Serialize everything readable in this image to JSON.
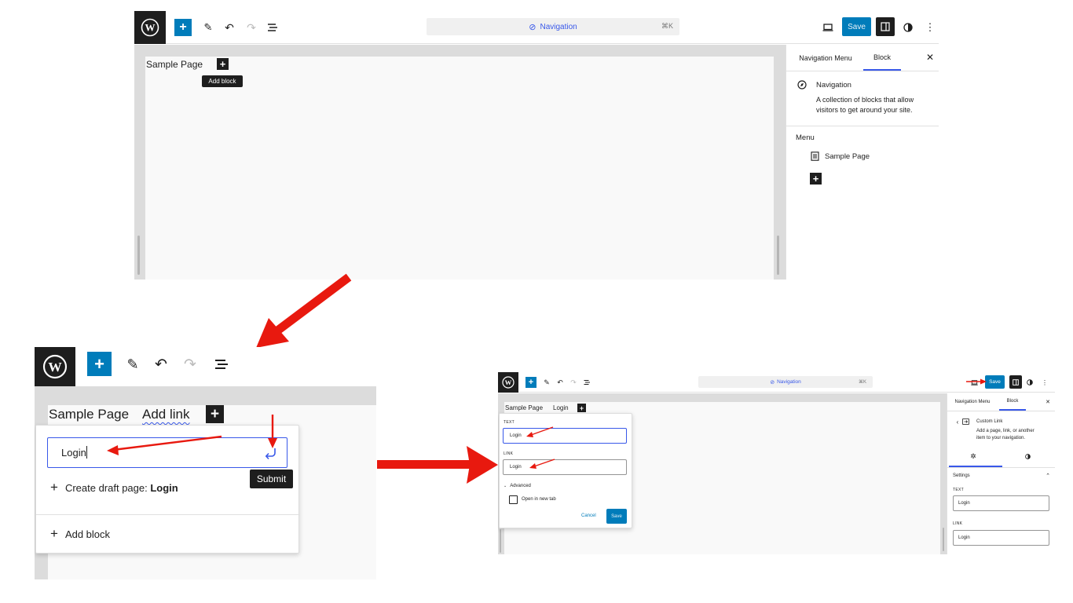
{
  "panel1": {
    "command_bar": {
      "label": "Navigation",
      "shortcut": "⌘K"
    },
    "toolbar": {
      "save_label": "Save"
    },
    "canvas": {
      "nav_item": "Sample Page",
      "tooltip": "Add block"
    },
    "sidebar": {
      "tabs": [
        "Navigation Menu",
        "Block"
      ],
      "block_title": "Navigation",
      "block_desc_line1": "A collection of blocks that allow",
      "block_desc_line2": "visitors to get around your site.",
      "menu_heading": "Menu",
      "menu_item": "Sample Page"
    }
  },
  "panel2": {
    "nav_items": [
      "Sample Page",
      "Add link"
    ],
    "input_value": "Login",
    "submit_tooltip": "Submit",
    "create_draft_prefix": "Create draft page: ",
    "create_draft_name": "Login",
    "add_block": "Add block"
  },
  "panel3": {
    "command_bar": {
      "label": "Navigation",
      "shortcut": "⌘K"
    },
    "toolbar": {
      "save_label": "Save"
    },
    "canvas": {
      "nav_items": [
        "Sample Page",
        "Login"
      ]
    },
    "popover": {
      "text_label": "TEXT",
      "text_value": "Login",
      "link_label": "LINK",
      "link_value": "Login",
      "advanced": "Advanced",
      "new_tab": "Open in new tab",
      "cancel": "Cancel",
      "save": "Save"
    },
    "sidebar": {
      "tabs": [
        "Navigation Menu",
        "Block"
      ],
      "block_title": "Custom Link",
      "block_desc_line1": "Add a page, link, or another",
      "block_desc_line2": "item to your navigation.",
      "settings": "Settings",
      "text_label": "TEXT",
      "text_value": "Login",
      "link_label": "LINK",
      "link_value": "Login"
    }
  },
  "colors": {
    "arrow": "#e8190f",
    "accent": "#007cba",
    "focus": "#3858e9",
    "dark": "#1e1e1e"
  }
}
